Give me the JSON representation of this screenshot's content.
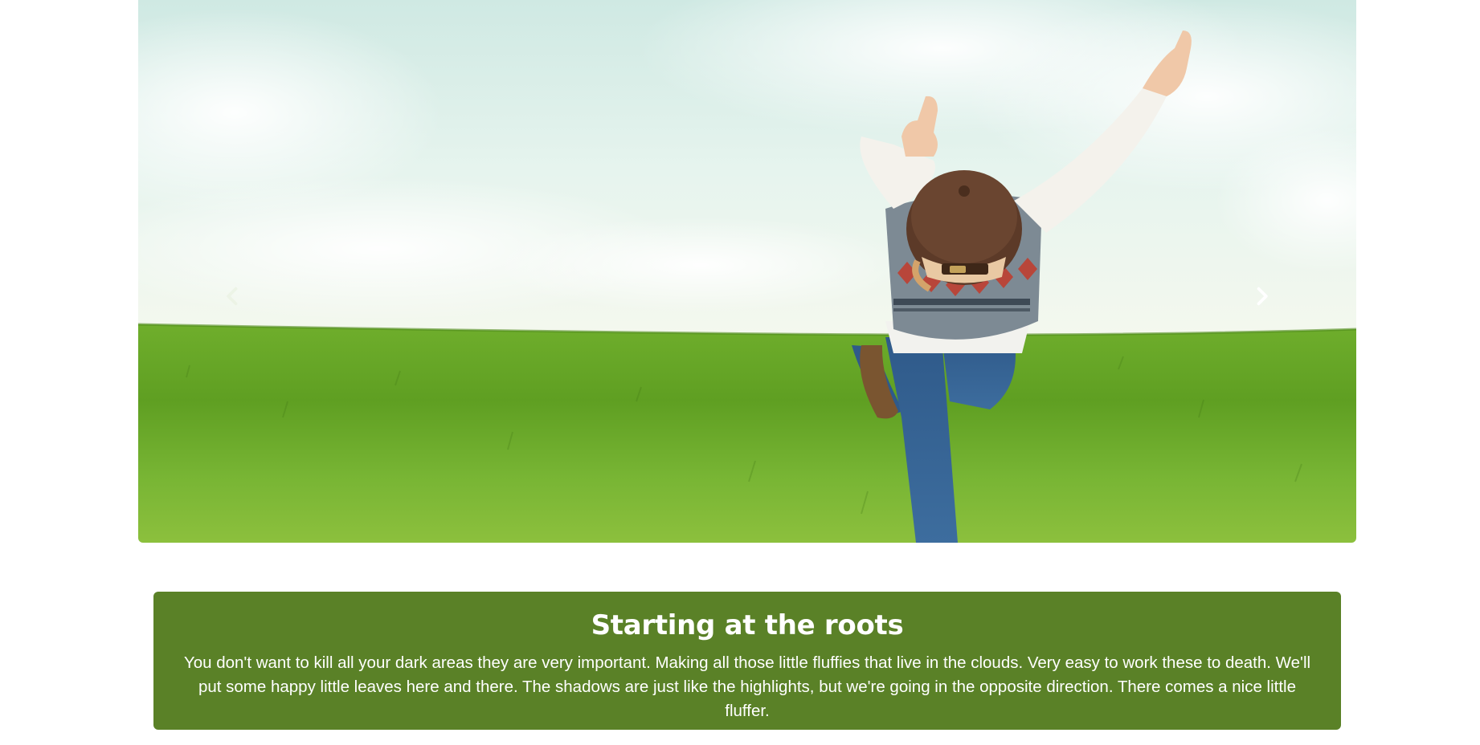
{
  "carousel": {
    "image_alt": "Child playing airplane in a green grassy field under a bright sky",
    "prev_icon": "chevron-left-icon",
    "next_icon": "chevron-right-icon"
  },
  "caption": {
    "title": "Starting at the roots",
    "body": "You don't want to kill all your dark areas they are very important. Making all those little fluffies that live in the clouds. Very easy to work these to death. We'll put some happy little leaves here and there. The shadows are just like the highlights, but we're going in the opposite direction. There comes a nice little fluffer."
  },
  "colors": {
    "caption_bg": "#5a8127",
    "caption_text": "#ffffff",
    "sky": "#dff2ec",
    "grass": "#6aa526"
  }
}
